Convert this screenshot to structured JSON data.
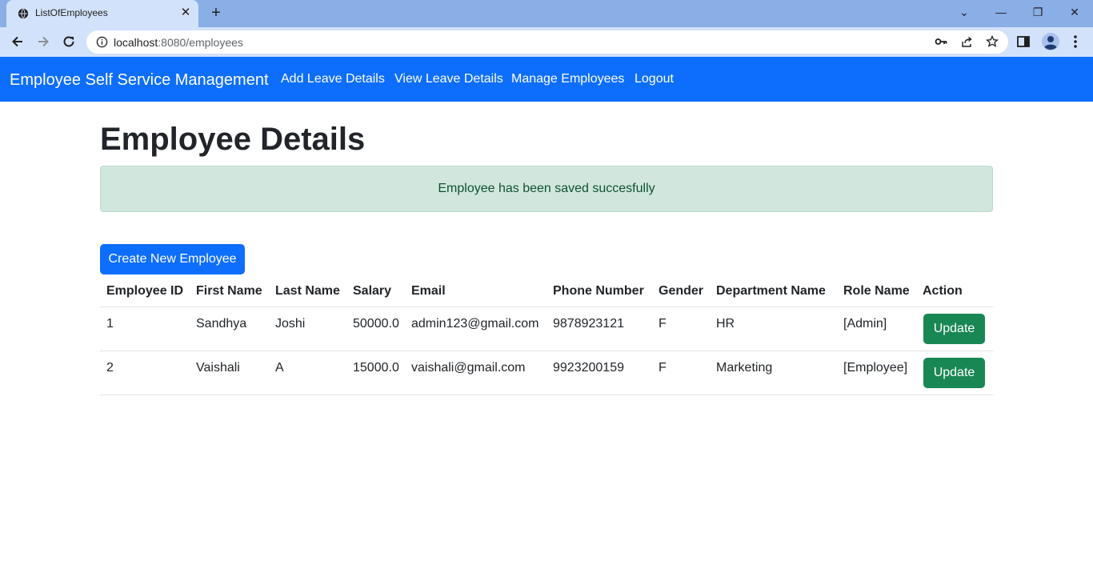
{
  "browser": {
    "tab_title": "ListOfEmployees",
    "tab_close": "✕",
    "new_tab": "+",
    "url_host": "localhost",
    "url_rest": ":8080/employees",
    "window_controls": {
      "minimize": "—",
      "restore": "❐",
      "close": "✕",
      "tab_search": "⌄"
    }
  },
  "navbar": {
    "brand": "Employee Self Service Management",
    "links": [
      "Add Leave Details",
      "View Leave Details",
      "Manage Employees",
      "Logout"
    ]
  },
  "page": {
    "title": "Employee Details",
    "alert": "Employee has been saved succesfully",
    "create_button": "Create New Employee"
  },
  "table": {
    "headers": [
      "Employee ID",
      "First Name",
      "Last Name",
      "Salary",
      "Email",
      "Phone Number",
      "Gender",
      "Department Name",
      "Role Name",
      "Action"
    ],
    "rows": [
      {
        "id": "1",
        "first": "Sandhya",
        "last": "Joshi",
        "salary": "50000.0",
        "email": "admin123@gmail.com",
        "phone": "9878923121",
        "gender": "F",
        "department": "HR",
        "role": "[Admin]",
        "action": "Update"
      },
      {
        "id": "2",
        "first": "Vaishali",
        "last": "A",
        "salary": "15000.0",
        "email": "vaishali@gmail.com",
        "phone": "9923200159",
        "gender": "F",
        "department": "Marketing",
        "role": "[Employee]",
        "action": "Update"
      }
    ]
  },
  "colors": {
    "primary": "#0d6efd",
    "success": "#198754",
    "alert_bg": "#d1e7dd",
    "alert_text": "#0f5132"
  }
}
